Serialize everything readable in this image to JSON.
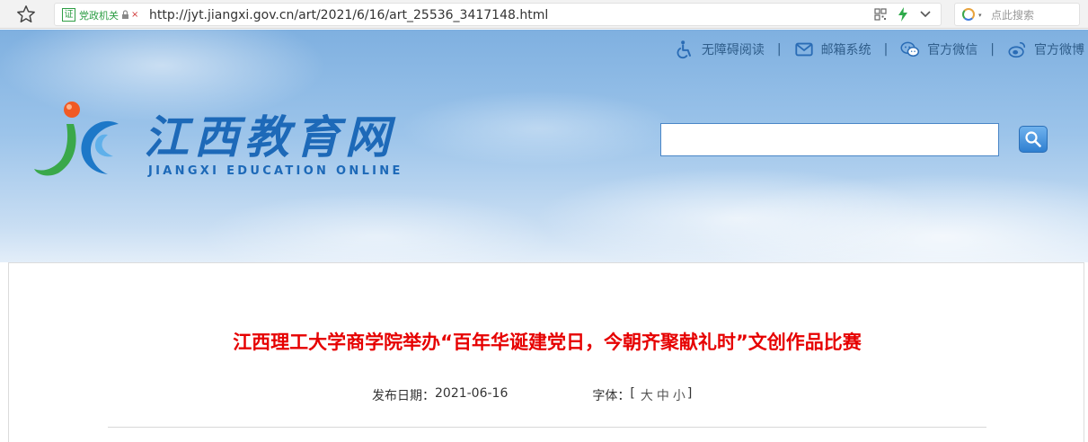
{
  "browser": {
    "cert_badge": "证",
    "cert_label": "党政机关",
    "cert_mark": "×",
    "url": "http://jyt.jiangxi.gov.cn/art/2021/6/16/art_25536_3417148.html",
    "search_placeholder": "点此搜索",
    "search_caret": "▾"
  },
  "header": {
    "top_links": [
      {
        "label": "无障碍阅读",
        "icon": "accessibility-icon"
      },
      {
        "label": "邮箱系统",
        "icon": "mail-icon"
      },
      {
        "label": "官方微信",
        "icon": "wechat-icon"
      },
      {
        "label": "官方微博",
        "icon": "weibo-icon"
      }
    ],
    "separator": "|",
    "site_name": "江西教育网",
    "site_name_en": "JIANGXI EDUCATION ONLINE",
    "search_value": ""
  },
  "article": {
    "title": "江西理工大学商学院举办“百年华诞建党日，今朝齐聚献礼时”文创作品比赛",
    "date_label": "发布日期：",
    "date": "2021-06-16",
    "font_label": "字体：",
    "bracket_open": "[",
    "bracket_close": "]",
    "font_options": [
      "大",
      "中",
      "小"
    ]
  },
  "colors": {
    "title_red": "#e60000",
    "brand_blue": "#1d69b8",
    "link_blue": "#2f5d8a"
  }
}
